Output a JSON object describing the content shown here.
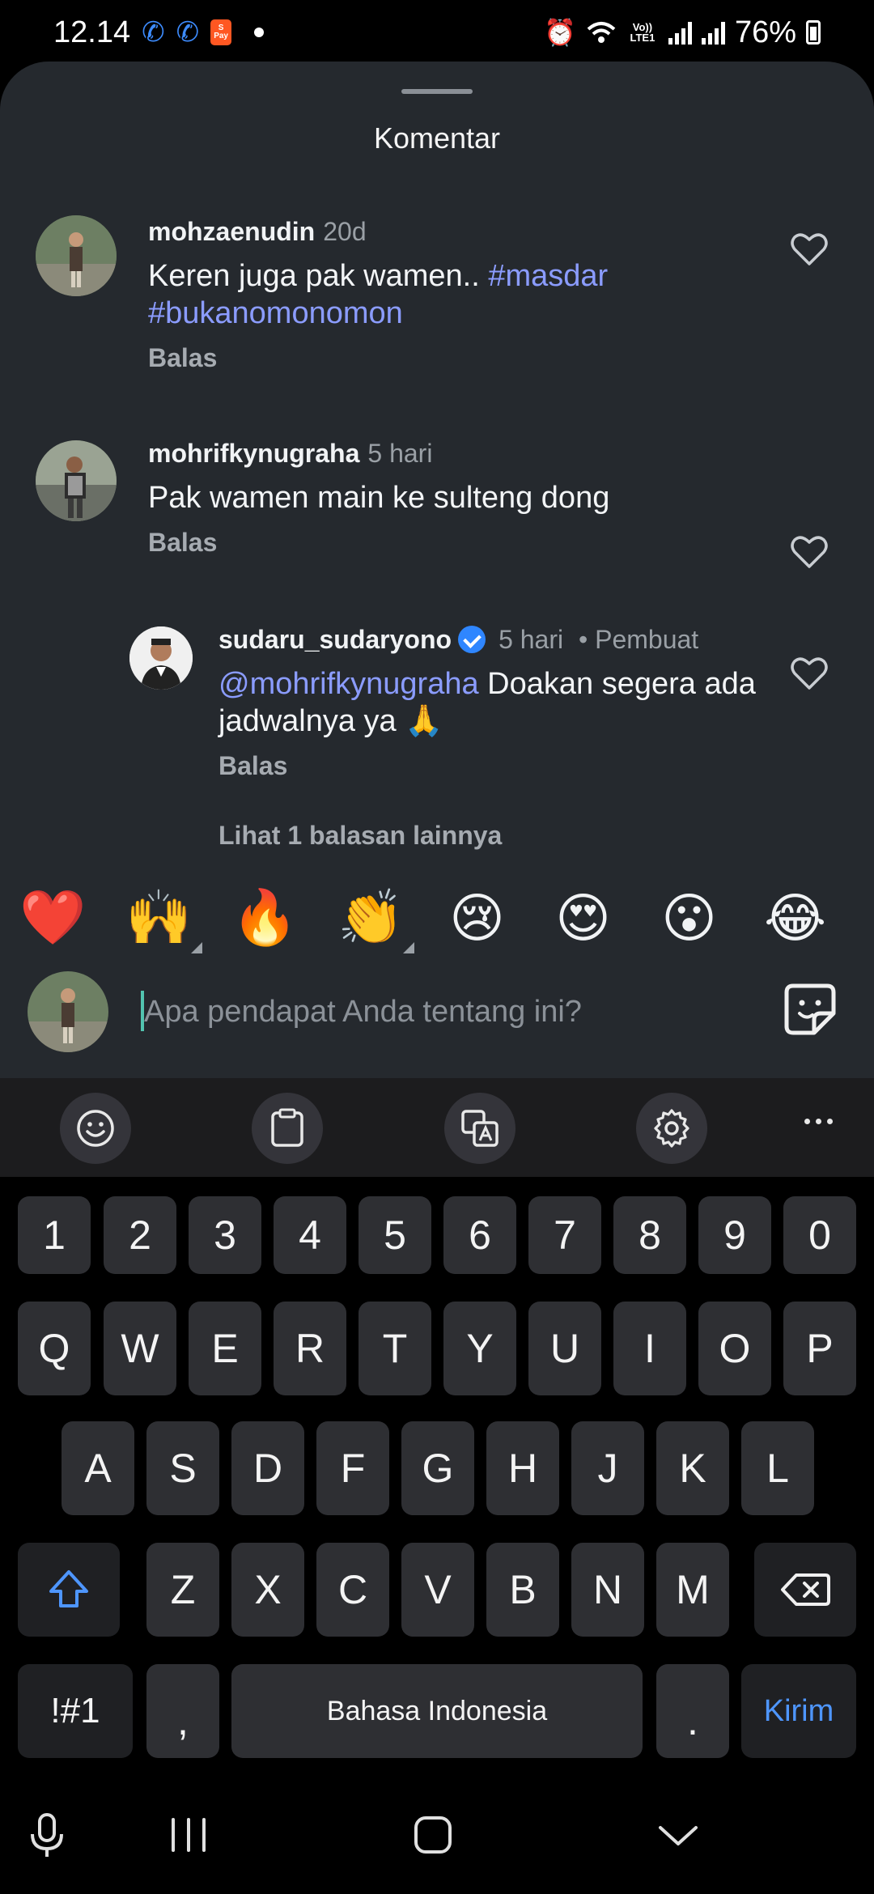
{
  "status_bar": {
    "time": "12.14",
    "pay_label": "Pay",
    "network_label": "Vo)) LTE1",
    "battery": "76%"
  },
  "sheet": {
    "title": "Komentar"
  },
  "comments": [
    {
      "username": "mohzaenudin",
      "time": "20d",
      "text_plain": "Keren juga pak wamen.. ",
      "tags": [
        "#masdar",
        "#bukanomonomon"
      ],
      "reply_label": "Balas"
    },
    {
      "username": "mohrifkynugraha",
      "time": "5 hari",
      "text_plain": "Pak wamen main ke sulteng dong",
      "reply_label": "Balas"
    },
    {
      "username": "sudaru_sudaryono",
      "time": "5 hari",
      "role": "Pembuat",
      "mention": "@mohrifkynugraha",
      "text_plain": " Doakan segera ada jadwalnya ya 🙏",
      "reply_label": "Balas"
    }
  ],
  "more_replies": "Lihat 1 balasan lainnya",
  "emoji_reactions": [
    "❤️",
    "🙌",
    "🔥",
    "👏",
    "😢",
    "😍",
    "😮",
    "😂"
  ],
  "input": {
    "placeholder": "Apa pendapat Anda tentang ini?"
  },
  "keyboard": {
    "toolbar": [
      "emoji-icon",
      "clipboard-icon",
      "translate-icon",
      "settings-icon",
      "more-icon"
    ],
    "number_row": [
      "1",
      "2",
      "3",
      "4",
      "5",
      "6",
      "7",
      "8",
      "9",
      "0"
    ],
    "row1": [
      "Q",
      "W",
      "E",
      "R",
      "T",
      "Y",
      "U",
      "I",
      "O",
      "P"
    ],
    "row2": [
      "A",
      "S",
      "D",
      "F",
      "G",
      "H",
      "J",
      "K",
      "L"
    ],
    "row3": [
      "Z",
      "X",
      "C",
      "V",
      "B",
      "N",
      "M"
    ],
    "symbols_label": "!#1",
    "comma": ",",
    "space_label": "Bahasa Indonesia",
    "period": ".",
    "send_label": "Kirim"
  },
  "colors": {
    "sheet_bg": "#25292e",
    "accent_link": "#8b9cff",
    "send_blue": "#4e96ff",
    "verified": "#2f86ff"
  }
}
